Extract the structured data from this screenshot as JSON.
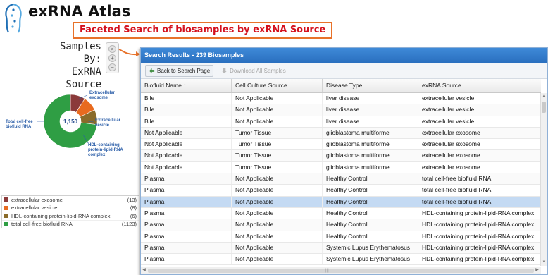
{
  "header": {
    "app_title": "exRNA Atlas",
    "callout": "Faceted Search of biosamples by exRNA Source"
  },
  "facet_heading": {
    "line1": "Samples By:",
    "line2": "ExRNA Source"
  },
  "side_tools": [
    "search-icon",
    "plus-icon",
    "minus-icon"
  ],
  "donut": {
    "center_label": "1,150",
    "slice_labels": {
      "exosome": "Extracellular exosome",
      "vesicle": "Extracellular vesicle",
      "hdl": "HDL-containing protein-lipid-RNA complex",
      "total": "Total cell-free biofluid RNA"
    },
    "colors": {
      "exosome": "#8b3a3a",
      "vesicle": "#e86a1f",
      "hdl": "#8a6b2a",
      "total": "#2f9e44"
    }
  },
  "legend": [
    {
      "label": "extracellular exosome",
      "count": "(13)",
      "color": "#8b3a3a"
    },
    {
      "label": "extracellular vesicle",
      "count": "(8)",
      "color": "#e86a1f"
    },
    {
      "label": "HDL-containing protein-lipid-RNA complex",
      "count": "(6)",
      "color": "#8a6b2a"
    },
    {
      "label": "total cell-free biofluid RNA",
      "count": "(1123)",
      "color": "#2f9e44"
    }
  ],
  "results": {
    "title": "Search Results - 239 Biosamples",
    "back_label": "Back to Search Page",
    "download_label": "Download All Samples",
    "columns": [
      "Biofluid Name ↑",
      "Cell Culture Source",
      "Disease Type",
      "exRNA Source"
    ],
    "rows": [
      [
        "Bile",
        "Not Applicable",
        "liver disease",
        "extracellular vesicle"
      ],
      [
        "Bile",
        "Not Applicable",
        "liver disease",
        "extracellular vesicle"
      ],
      [
        "Bile",
        "Not Applicable",
        "liver disease",
        "extracellular vesicle"
      ],
      [
        "Not Applicable",
        "Tumor Tissue",
        "glioblastoma multiforme",
        "extracellular exosome"
      ],
      [
        "Not Applicable",
        "Tumor Tissue",
        "glioblastoma multiforme",
        "extracellular exosome"
      ],
      [
        "Not Applicable",
        "Tumor Tissue",
        "glioblastoma multiforme",
        "extracellular exosome"
      ],
      [
        "Not Applicable",
        "Tumor Tissue",
        "glioblastoma multiforme",
        "extracellular exosome"
      ],
      [
        "Plasma",
        "Not Applicable",
        "Healthy Control",
        "total cell-free biofluid RNA"
      ],
      [
        "Plasma",
        "Not Applicable",
        "Healthy Control",
        "total cell-free biofluid RNA"
      ],
      [
        "Plasma",
        "Not Applicable",
        "Healthy Control",
        "total cell-free biofluid RNA"
      ],
      [
        "Plasma",
        "Not Applicable",
        "Healthy Control",
        "HDL-containing protein-lipid-RNA complex"
      ],
      [
        "Plasma",
        "Not Applicable",
        "Healthy Control",
        "HDL-containing protein-lipid-RNA complex"
      ],
      [
        "Plasma",
        "Not Applicable",
        "Healthy Control",
        "HDL-containing protein-lipid-RNA complex"
      ],
      [
        "Plasma",
        "Not Applicable",
        "Systemic Lupus Erythematosus",
        "HDL-containing protein-lipid-RNA complex"
      ],
      [
        "Plasma",
        "Not Applicable",
        "Systemic Lupus Erythematosus",
        "HDL-containing protein-lipid-RNA complex"
      ]
    ],
    "selected_row": 9
  }
}
